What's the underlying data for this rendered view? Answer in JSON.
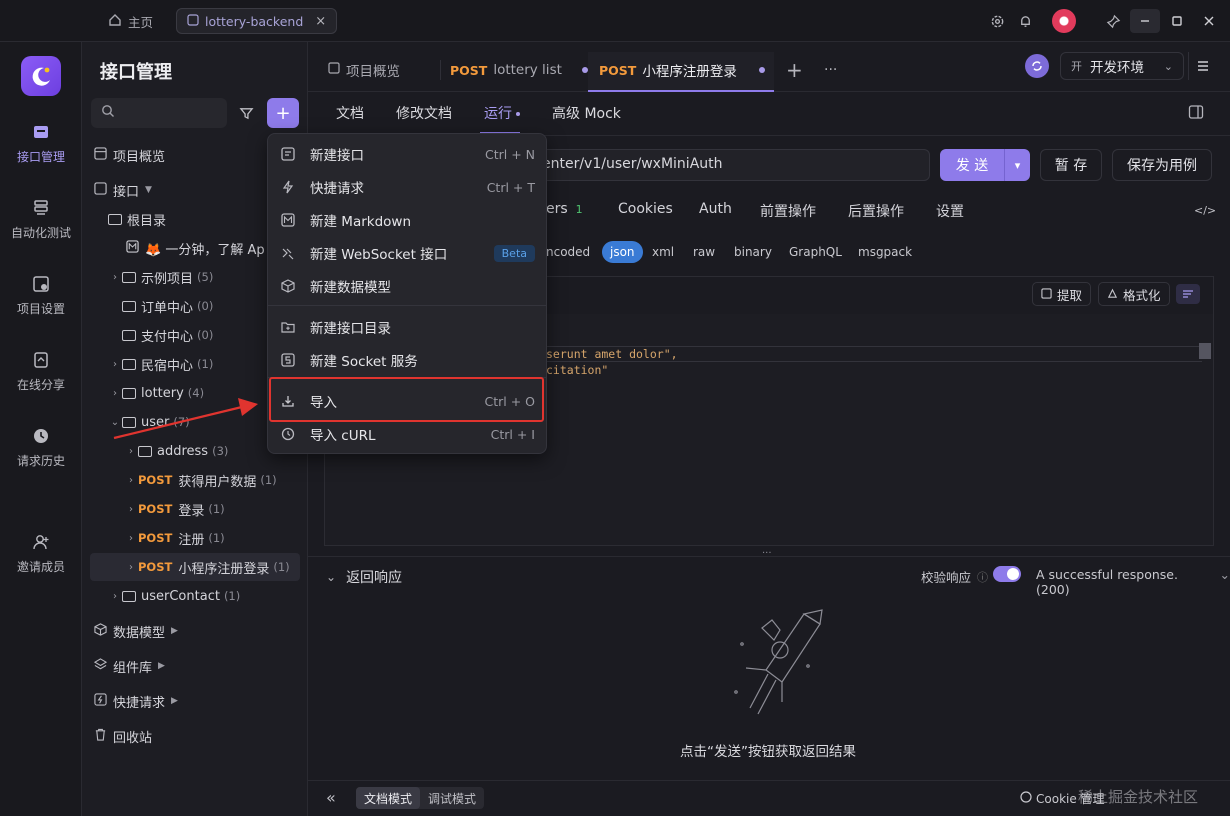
{
  "topbar": {
    "home_label": "主页",
    "tab_label": "lottery-backend",
    "tab_close": "×"
  },
  "rail": [
    {
      "label": "接口管理",
      "icon": "api-icon"
    },
    {
      "label": "自动化测试",
      "icon": "automation-icon"
    },
    {
      "label": "项目设置",
      "icon": "project-settings-icon"
    },
    {
      "label": "在线分享",
      "icon": "share-icon"
    },
    {
      "label": "请求历史",
      "icon": "history-icon"
    },
    {
      "label": "邀请成员",
      "icon": "invite-icon"
    }
  ],
  "sidebar": {
    "title": "接口管理",
    "overview": "项目概览",
    "api": "接口",
    "root": "根目录",
    "doc_item": "🦊 一分钟，了解 Ap",
    "folders": [
      {
        "label": "示例项目",
        "count": "(5)"
      },
      {
        "label": "订单中心",
        "count": "(0)"
      },
      {
        "label": "支付中心",
        "count": "(0)"
      },
      {
        "label": "民宿中心",
        "count": "(1)"
      },
      {
        "label": "lottery",
        "count": "(4)"
      },
      {
        "label": "user",
        "count": "(7)"
      },
      {
        "label": "address",
        "count": "(3)"
      }
    ],
    "endpoints": [
      {
        "method": "POST",
        "label": "获得用户数据",
        "count": "(1)"
      },
      {
        "method": "POST",
        "label": "登录",
        "count": "(1)"
      },
      {
        "method": "POST",
        "label": "注册",
        "count": "(1)"
      },
      {
        "method": "POST",
        "label": "小程序注册登录",
        "count": "(1)"
      }
    ],
    "userContact": {
      "label": "userContact",
      "count": "(1)"
    },
    "bottom": [
      "数据模型",
      "组件库",
      "快捷请求",
      "回收站"
    ]
  },
  "tabs": {
    "overview": "项目概览",
    "t1_method": "POST",
    "t1_label": "lottery list",
    "t2_method": "POST",
    "t2_label": "小程序注册登录",
    "add": "+",
    "more": "···",
    "env": "开发环境",
    "env_badge": "开"
  },
  "subtabs": {
    "doc": "文档",
    "edit": "修改文档",
    "run": "运行",
    "mock": "高级 Mock"
  },
  "request": {
    "url": "enter/v1/user/wxMiniAuth",
    "send": "发 送",
    "save": "暂 存",
    "save_case": "保存为用例",
    "tabs": {
      "headers": "ers",
      "headers_count": "1",
      "cookies": "Cookies",
      "auth": "Auth",
      "pre": "前置操作",
      "post": "后置操作",
      "settings": "设置"
    },
    "body_types": [
      "ncoded",
      "json",
      "xml",
      "raw",
      "binary",
      "GraphQL",
      "msgpack"
    ],
    "extract": "提取",
    "format": "格式化",
    "code_lines": [
      "serunt amet dolor\",",
      "citation\""
    ]
  },
  "menu": {
    "items": [
      {
        "label": "新建接口",
        "shortcut": "Ctrl + N",
        "icon": "api-doc-icon"
      },
      {
        "label": "快捷请求",
        "shortcut": "Ctrl + T",
        "icon": "lightning-icon"
      },
      {
        "label": "新建 Markdown",
        "shortcut": "",
        "icon": "markdown-icon"
      },
      {
        "label": "新建 WebSocket 接口",
        "shortcut": "",
        "beta": "Beta",
        "icon": "websocket-icon"
      },
      {
        "label": "新建数据模型",
        "shortcut": "",
        "icon": "cube-icon"
      },
      {
        "label": "新建接口目录",
        "shortcut": "",
        "icon": "folder-plus-icon"
      },
      {
        "label": "新建 Socket 服务",
        "shortcut": "",
        "icon": "socket-icon"
      },
      {
        "label": "导入",
        "shortcut": "Ctrl + O",
        "icon": "import-icon"
      },
      {
        "label": "导入 cURL",
        "shortcut": "Ctrl + I",
        "icon": "curl-icon"
      }
    ]
  },
  "response": {
    "title": "返回响应",
    "validate": "校验响应",
    "status": "A successful response. (200)",
    "empty_hint": "点击“发送”按钮获取返回结果"
  },
  "bottom": {
    "doc_mode": "文档模式",
    "debug_mode": "调试模式",
    "cookie": "Cookie 管理",
    "watermark": "稀土掘金技术社区"
  },
  "colors": {
    "accent": "#8e7bea",
    "post": "#f39a3c",
    "highlight": "#e0342f"
  }
}
